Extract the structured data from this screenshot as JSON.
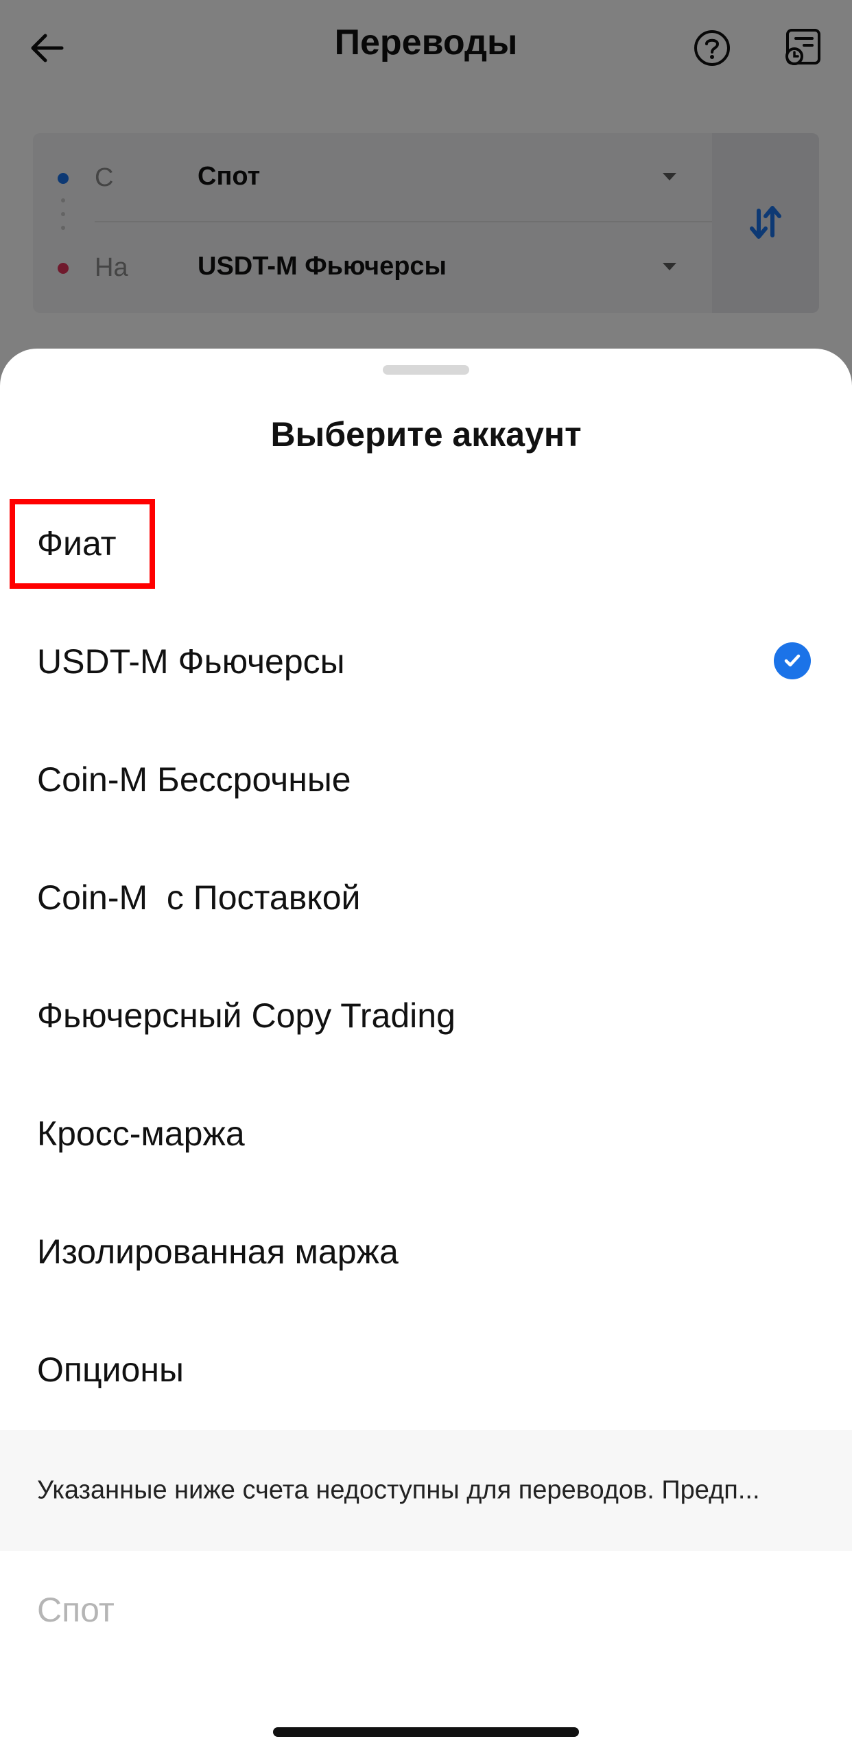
{
  "header": {
    "title": "Переводы",
    "back_icon": "arrow-left-icon",
    "help_icon": "question-circle-icon",
    "history_icon": "history-record-icon"
  },
  "transfer": {
    "from": {
      "prefix": "С",
      "value": "Спот",
      "dot_color": "#1b73e8"
    },
    "to": {
      "prefix": "На",
      "value": "USDT-M Фьючерсы",
      "dot_color": "#e0345a"
    },
    "swap_icon": "swap-arrows-icon"
  },
  "sheet": {
    "title": "Выберите аккаунт",
    "options": [
      {
        "label": "Фиат",
        "selected": false
      },
      {
        "label": "USDT-M Фьючерсы",
        "selected": true
      },
      {
        "label": "Coin-M Бессрочные",
        "selected": false
      },
      {
        "label": "Coin-M  с Поставкой",
        "selected": false
      },
      {
        "label": "Фьючерсный Copy Trading",
        "selected": false
      },
      {
        "label": "Кросс-маржа",
        "selected": false
      },
      {
        "label": "Изолированная маржа",
        "selected": false
      },
      {
        "label": "Опционы",
        "selected": false
      }
    ],
    "notice": "Указанные ниже счета недоступны для переводов. Предп...",
    "unavailable": [
      {
        "label": "Спот"
      }
    ],
    "check_icon": "check-circle-icon"
  },
  "colors": {
    "accent": "#1b73e8",
    "highlight": "#ff0000"
  }
}
